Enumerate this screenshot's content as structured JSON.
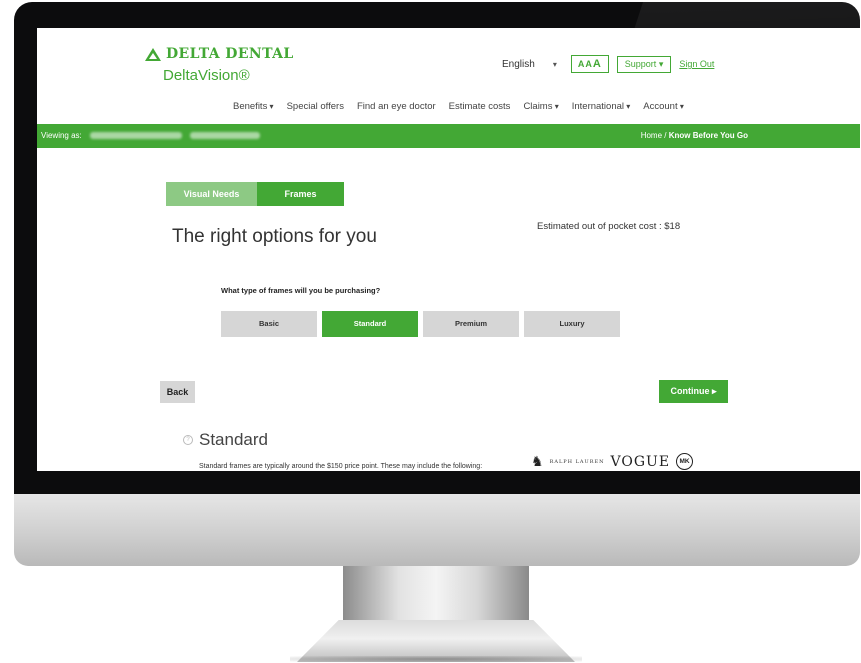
{
  "brand": {
    "logo": "DELTA DENTAL",
    "sub": "DeltaVision®"
  },
  "utility": {
    "language": "English",
    "text_size": [
      "A",
      "A",
      "A"
    ],
    "support": "Support",
    "sign_out": "Sign Out"
  },
  "nav": [
    "Benefits",
    "Special offers",
    "Find an eye doctor",
    "Estimate costs",
    "Claims",
    "International",
    "Account"
  ],
  "viewing_bar": {
    "label": "Viewing as:",
    "crumb_home": "Home",
    "crumb_sep": "/",
    "crumb_current": "Know Before You Go"
  },
  "tabs": [
    "Visual Needs",
    "Frames"
  ],
  "page_title": "The right options for you",
  "estimate": "Estimated out of pocket cost : $18",
  "question": "What type of frames will you be purchasing?",
  "frame_options": [
    "Basic",
    "Standard",
    "Premium",
    "Luxury"
  ],
  "selected_option": "Standard",
  "buttons": {
    "back": "Back",
    "continue": "Continue"
  },
  "section": {
    "title": "Standard",
    "description": "Standard frames are typically around the $150 price point. These may include the following:",
    "brands": [
      "RALPH LAUREN",
      "VOGUE",
      "MK"
    ]
  },
  "colors": {
    "accent": "#43a835",
    "accent_light": "#8dc984",
    "button_gray": "#d6d6d6"
  }
}
